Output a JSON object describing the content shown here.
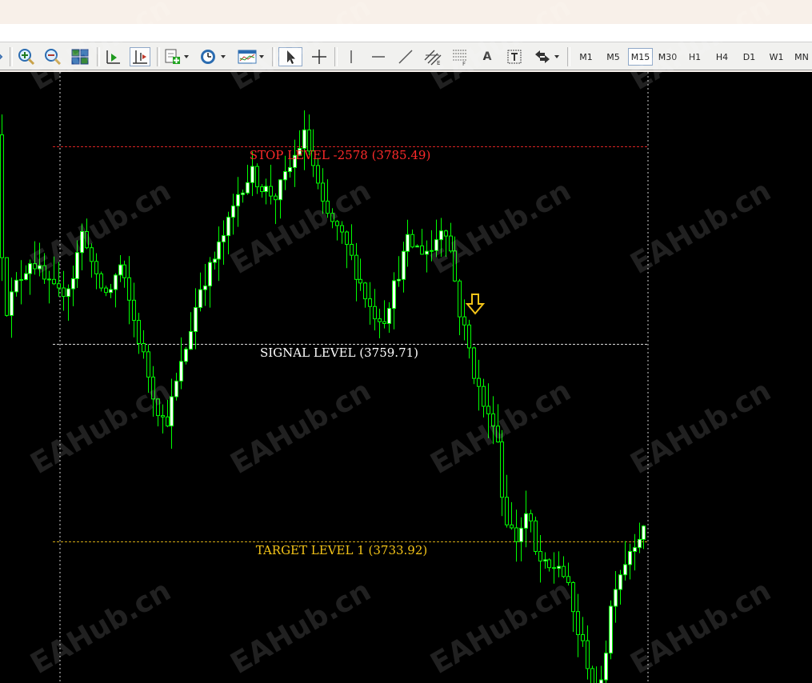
{
  "toolbar": {
    "tools": [
      {
        "name": "zoom-in-icon"
      },
      {
        "name": "zoom-out-icon"
      },
      {
        "name": "tile-windows-icon"
      },
      {
        "name": "auto-scroll-icon"
      },
      {
        "name": "chart-shift-icon"
      },
      {
        "name": "indicators-icon"
      },
      {
        "name": "periods-icon"
      },
      {
        "name": "templates-icon"
      },
      {
        "name": "cursor-icon"
      },
      {
        "name": "crosshair-icon"
      },
      {
        "name": "vertical-line-icon"
      },
      {
        "name": "horizontal-line-icon"
      },
      {
        "name": "trendline-icon"
      },
      {
        "name": "equidistant-channel-icon"
      },
      {
        "name": "fibonacci-icon"
      },
      {
        "name": "text-label-icon"
      },
      {
        "name": "text-box-icon"
      },
      {
        "name": "arrows-icon"
      }
    ],
    "text_tool_glyph": "A",
    "timeframes": [
      "M1",
      "M5",
      "M15",
      "M30",
      "H1",
      "H4",
      "D1",
      "W1",
      "MN"
    ],
    "active_timeframe": "M15"
  },
  "chart": {
    "background": "#000000",
    "candle_color": "#00ff00",
    "bull_body_color": "#ffffff",
    "levels": [
      {
        "key": "stop",
        "text": "STOP LEVEL -2578 (3785.49)",
        "color": "#ff2a2a",
        "price": 3785.49
      },
      {
        "key": "signal",
        "text": "SIGNAL LEVEL (3759.71)",
        "color": "#ffffff",
        "price": 3759.71
      },
      {
        "key": "target",
        "text": "TARGET LEVEL 1 (3733.92)",
        "color": "#f5c518",
        "price": 3733.92
      }
    ],
    "signal_arrow": {
      "direction": "down",
      "color": "#f5c518"
    },
    "watermark": "EAHub.cn"
  }
}
